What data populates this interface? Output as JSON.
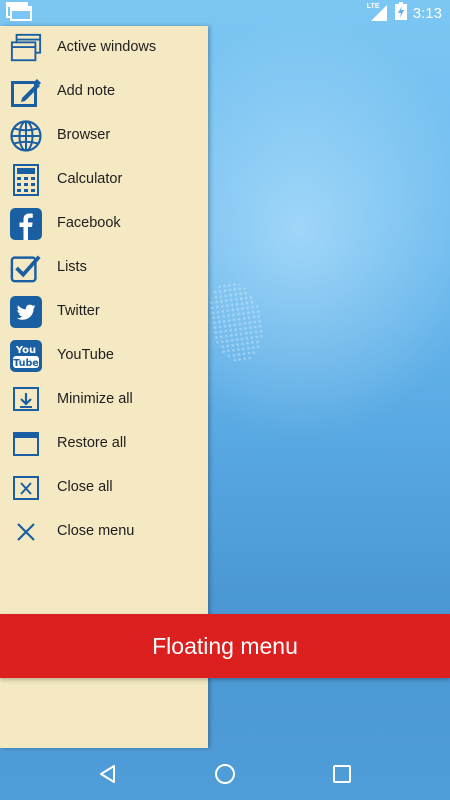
{
  "status_bar": {
    "time": "3:13",
    "network": "LTE"
  },
  "menu": {
    "items": [
      {
        "label": "Active windows",
        "icon": "active-windows-icon"
      },
      {
        "label": "Add note",
        "icon": "add-note-icon"
      },
      {
        "label": "Browser",
        "icon": "globe-icon"
      },
      {
        "label": "Calculator",
        "icon": "calculator-icon"
      },
      {
        "label": "Facebook",
        "icon": "facebook-icon"
      },
      {
        "label": "Lists",
        "icon": "checkbox-icon"
      },
      {
        "label": "Twitter",
        "icon": "twitter-icon"
      },
      {
        "label": "YouTube",
        "icon": "youtube-icon"
      },
      {
        "label": "Minimize all",
        "icon": "minimize-icon"
      },
      {
        "label": "Restore all",
        "icon": "restore-icon"
      },
      {
        "label": "Close all",
        "icon": "close-all-icon"
      },
      {
        "label": "Close menu",
        "icon": "close-icon"
      }
    ]
  },
  "banner": {
    "title": "Floating menu"
  },
  "colors": {
    "drawer_bg": "#f5e9c3",
    "icon_blue": "#1b5fa3",
    "banner_red": "#dc1f1f"
  }
}
